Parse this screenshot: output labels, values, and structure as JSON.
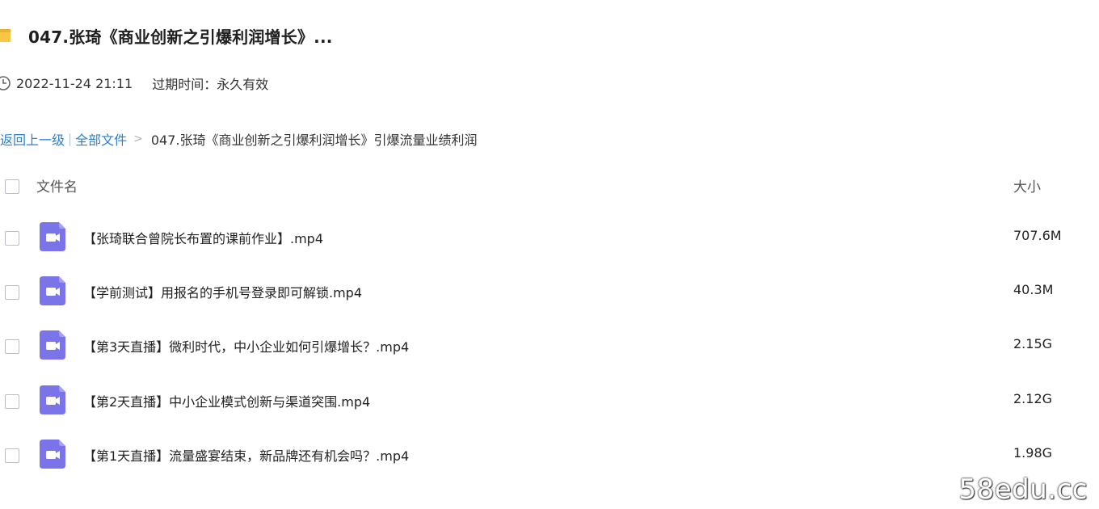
{
  "share": {
    "title": "047.张琦《商业创新之引爆利润增长》...",
    "date": "2022-11-24 21:11",
    "expiry": "过期时间：永久有效"
  },
  "breadcrumb": {
    "back": "返回上一级",
    "separator": "|",
    "all_files": "全部文件",
    "arrow": ">",
    "current": "047.张琦《商业创新之引爆利润增长》引爆流量业绩利润"
  },
  "table": {
    "col_name": "文件名",
    "col_size": "大小",
    "rows": [
      {
        "name": "【张琦联合曾院长布置的课前作业】.mp4",
        "size": "707.6M"
      },
      {
        "name": "【学前测试】用报名的手机号登录即可解锁.mp4",
        "size": "40.3M"
      },
      {
        "name": "【第3天直播】微利时代，中小企业如何引爆增长？.mp4",
        "size": "2.15G"
      },
      {
        "name": "【第2天直播】中小企业模式创新与渠道突围.mp4",
        "size": "2.12G"
      },
      {
        "name": "【第1天直播】流量盛宴结束，新品牌还有机会吗？.mp4",
        "size": "1.98G"
      }
    ]
  },
  "icons": {
    "folder": "folder-icon",
    "clock": "clock-icon",
    "video": "video-file-icon"
  },
  "colors": {
    "link": "#2b7fd3",
    "video_icon": "#7b73e8",
    "folder": "#f6c644"
  },
  "watermark": "58edu.cc"
}
